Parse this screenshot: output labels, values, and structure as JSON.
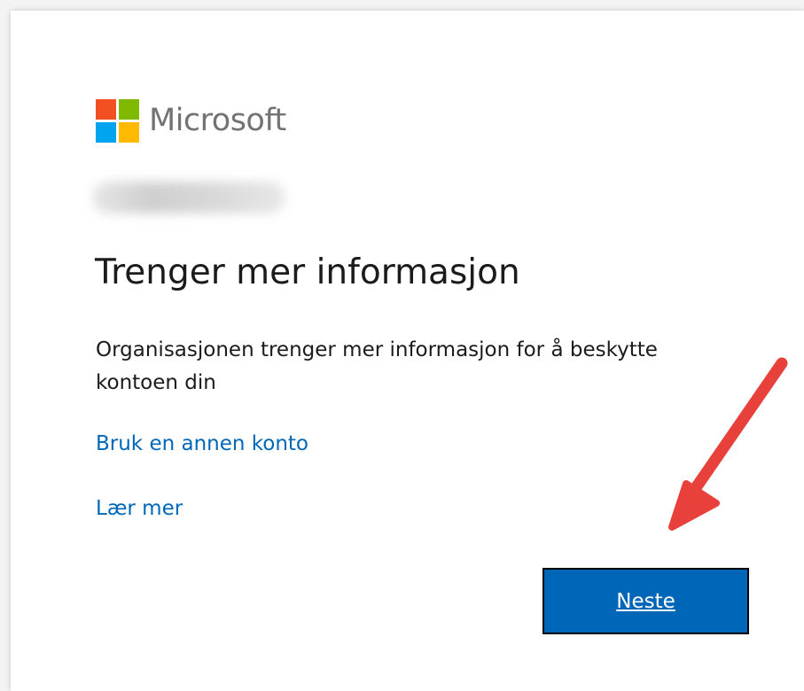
{
  "brand": {
    "name": "Microsoft",
    "logo_colors": [
      "#f25022",
      "#7fba00",
      "#00a4ef",
      "#ffb900"
    ]
  },
  "account": {
    "identity": ""
  },
  "page": {
    "title": "Trenger mer informasjon",
    "description": "Organisasjonen trenger mer informasjon for å beskytte kontoen din"
  },
  "links": {
    "other_account": "Bruk en annen konto",
    "learn_more": "Lær mer"
  },
  "actions": {
    "next": "Neste"
  },
  "colors": {
    "link": "#0067b8",
    "button": "#0067b8",
    "annotation_arrow": "#e8413c"
  },
  "annotation": {
    "icon": "red-arrow-icon"
  }
}
